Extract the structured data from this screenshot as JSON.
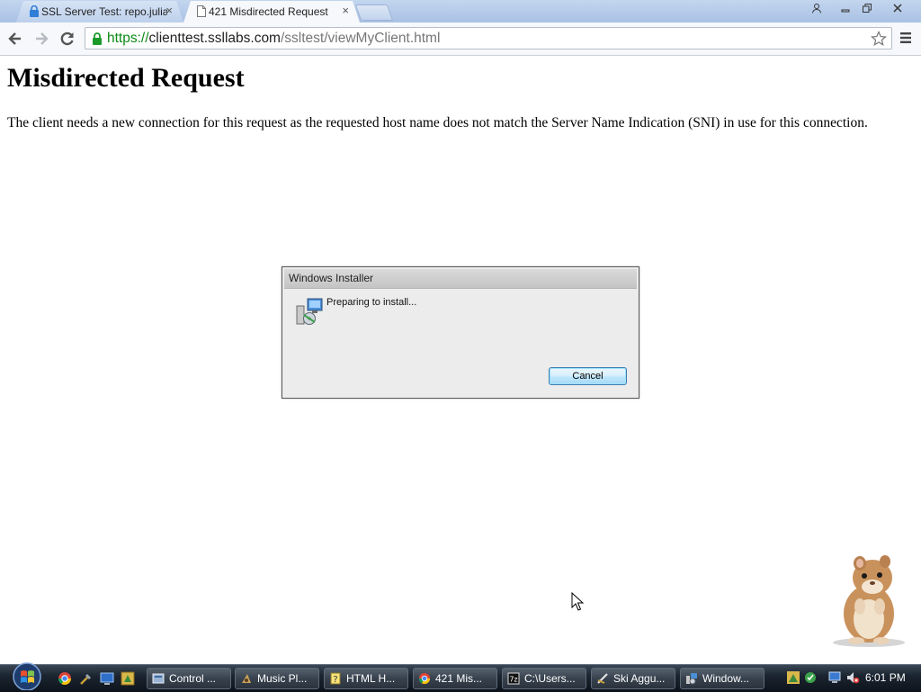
{
  "browser": {
    "tabs": [
      {
        "title": "SSL Server Test: repo.julia",
        "active": false,
        "icon": "lock-icon"
      },
      {
        "title": "421 Misdirected Request",
        "active": true,
        "icon": "document-icon"
      }
    ],
    "close_glyph": "×",
    "url": {
      "scheme": "https://",
      "host": "clienttest.ssllabs.com",
      "path": "/ssltest/viewMyClient.html"
    },
    "scheme_color": "#0a8a14"
  },
  "page": {
    "heading": "Misdirected Request",
    "body": "The client needs a new connection for this request as the requested host name does not match the Server Name Indication (SNI) in use for this connection."
  },
  "dialog": {
    "title": "Windows Installer",
    "message": "Preparing to install...",
    "cancel_label": "Cancel"
  },
  "taskbar": {
    "buttons": [
      {
        "label": "Control ...",
        "icon": "control-panel-icon"
      },
      {
        "label": "Music Pl...",
        "icon": "music-player-icon"
      },
      {
        "label": "HTML H...",
        "icon": "html-help-icon"
      },
      {
        "label": "421 Mis...",
        "icon": "chrome-icon"
      },
      {
        "label": "C:\\Users...",
        "icon": "7zip-icon"
      },
      {
        "label": "Ski Aggu...",
        "icon": "ski-icon"
      },
      {
        "label": "Window...",
        "icon": "windows-installer-icon"
      }
    ],
    "clock": "6:01 PM"
  }
}
